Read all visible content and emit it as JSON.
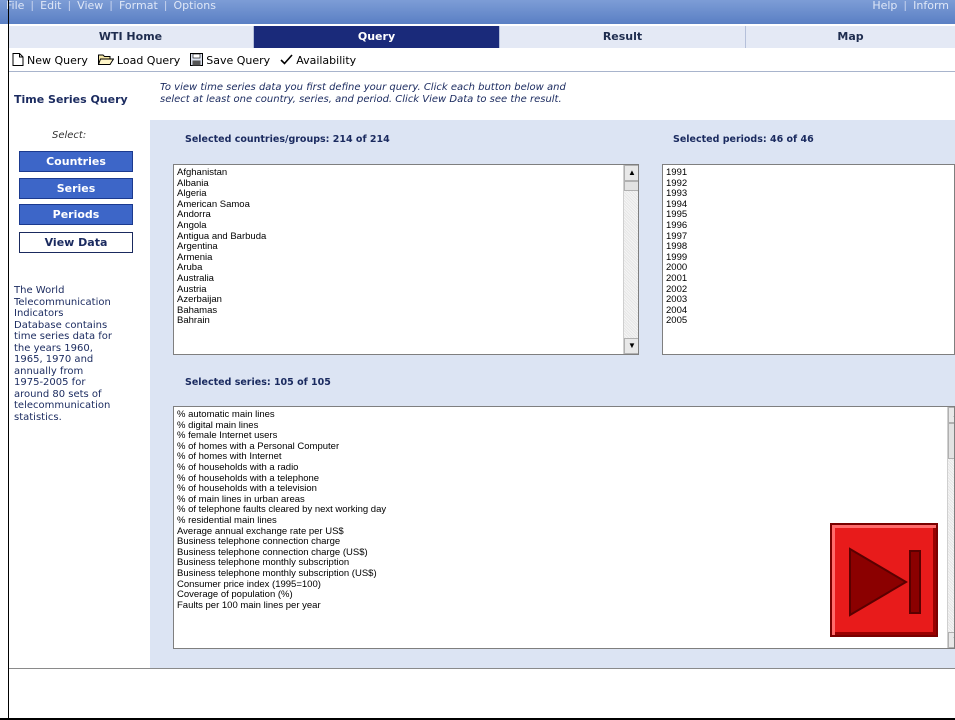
{
  "menu": {
    "left_items": [
      "File",
      "Edit",
      "View",
      "Format",
      "Options"
    ],
    "right_items": [
      "Help",
      "Inform"
    ]
  },
  "tabs": [
    {
      "label": "WTI Home",
      "active": false
    },
    {
      "label": "Query",
      "active": true
    },
    {
      "label": "Result",
      "active": false
    },
    {
      "label": "Map",
      "active": false
    }
  ],
  "toolbar": {
    "new_query": "New Query",
    "load_query": "Load Query",
    "save_query": "Save Query",
    "availability": "Availability"
  },
  "page": {
    "title": "Time Series Query",
    "instructions_line1": "To view time series data you first define your query. Click each button below and",
    "instructions_line2": "select at least one country, series, and period. Click View Data to see the result."
  },
  "sidebar": {
    "select_label": "Select:",
    "countries_btn": "Countries",
    "series_btn": "Series",
    "periods_btn": "Periods",
    "view_data_btn": "View Data",
    "about_lines": [
      "The World",
      "Telecommunication",
      "Indicators",
      "Database contains",
      "time series data for",
      "the years 1960,",
      "1965, 1970 and",
      "annually from",
      "1975-2005 for",
      "around 80 sets of",
      "telecommunication",
      "statistics."
    ]
  },
  "countries": {
    "label": "Selected countries/groups: 214 of 214",
    "items": [
      "Afghanistan",
      "Albania",
      "Algeria",
      "American Samoa",
      "Andorra",
      "Angola",
      "Antigua and Barbuda",
      "Argentina",
      "Armenia",
      "Aruba",
      "Australia",
      "Austria",
      "Azerbaijan",
      "Bahamas",
      "Bahrain"
    ]
  },
  "periods": {
    "label": "Selected periods: 46 of 46",
    "items": [
      "1991",
      "1992",
      "1993",
      "1994",
      "1995",
      "1996",
      "1997",
      "1998",
      "1999",
      "2000",
      "2001",
      "2002",
      "2003",
      "2004",
      "2005"
    ]
  },
  "series": {
    "label": "Selected series: 105 of 105",
    "items": [
      "% automatic main lines",
      "% digital main lines",
      "% female Internet users",
      "% of homes with a Personal Computer",
      "% of homes with Internet",
      "% of households with a radio",
      "% of households with a telephone",
      "% of households with a television",
      "% of main lines in urban areas",
      "% of telephone faults cleared by next working day",
      "% residential main lines",
      "Average annual exchange rate per US$",
      "Business telephone connection charge",
      "Business telephone connection charge (US$)",
      "Business telephone monthly subscription",
      "Business telephone monthly subscription (US$)",
      "Consumer price index (1995=100)",
      "Coverage of population (%)",
      "Faults per 100 main lines per year"
    ]
  },
  "colors": {
    "active_tab": "#1a2a7a",
    "side_button": "#3d66c8",
    "panel_bg": "#dce4f3",
    "play_button": "#e81b1b"
  }
}
